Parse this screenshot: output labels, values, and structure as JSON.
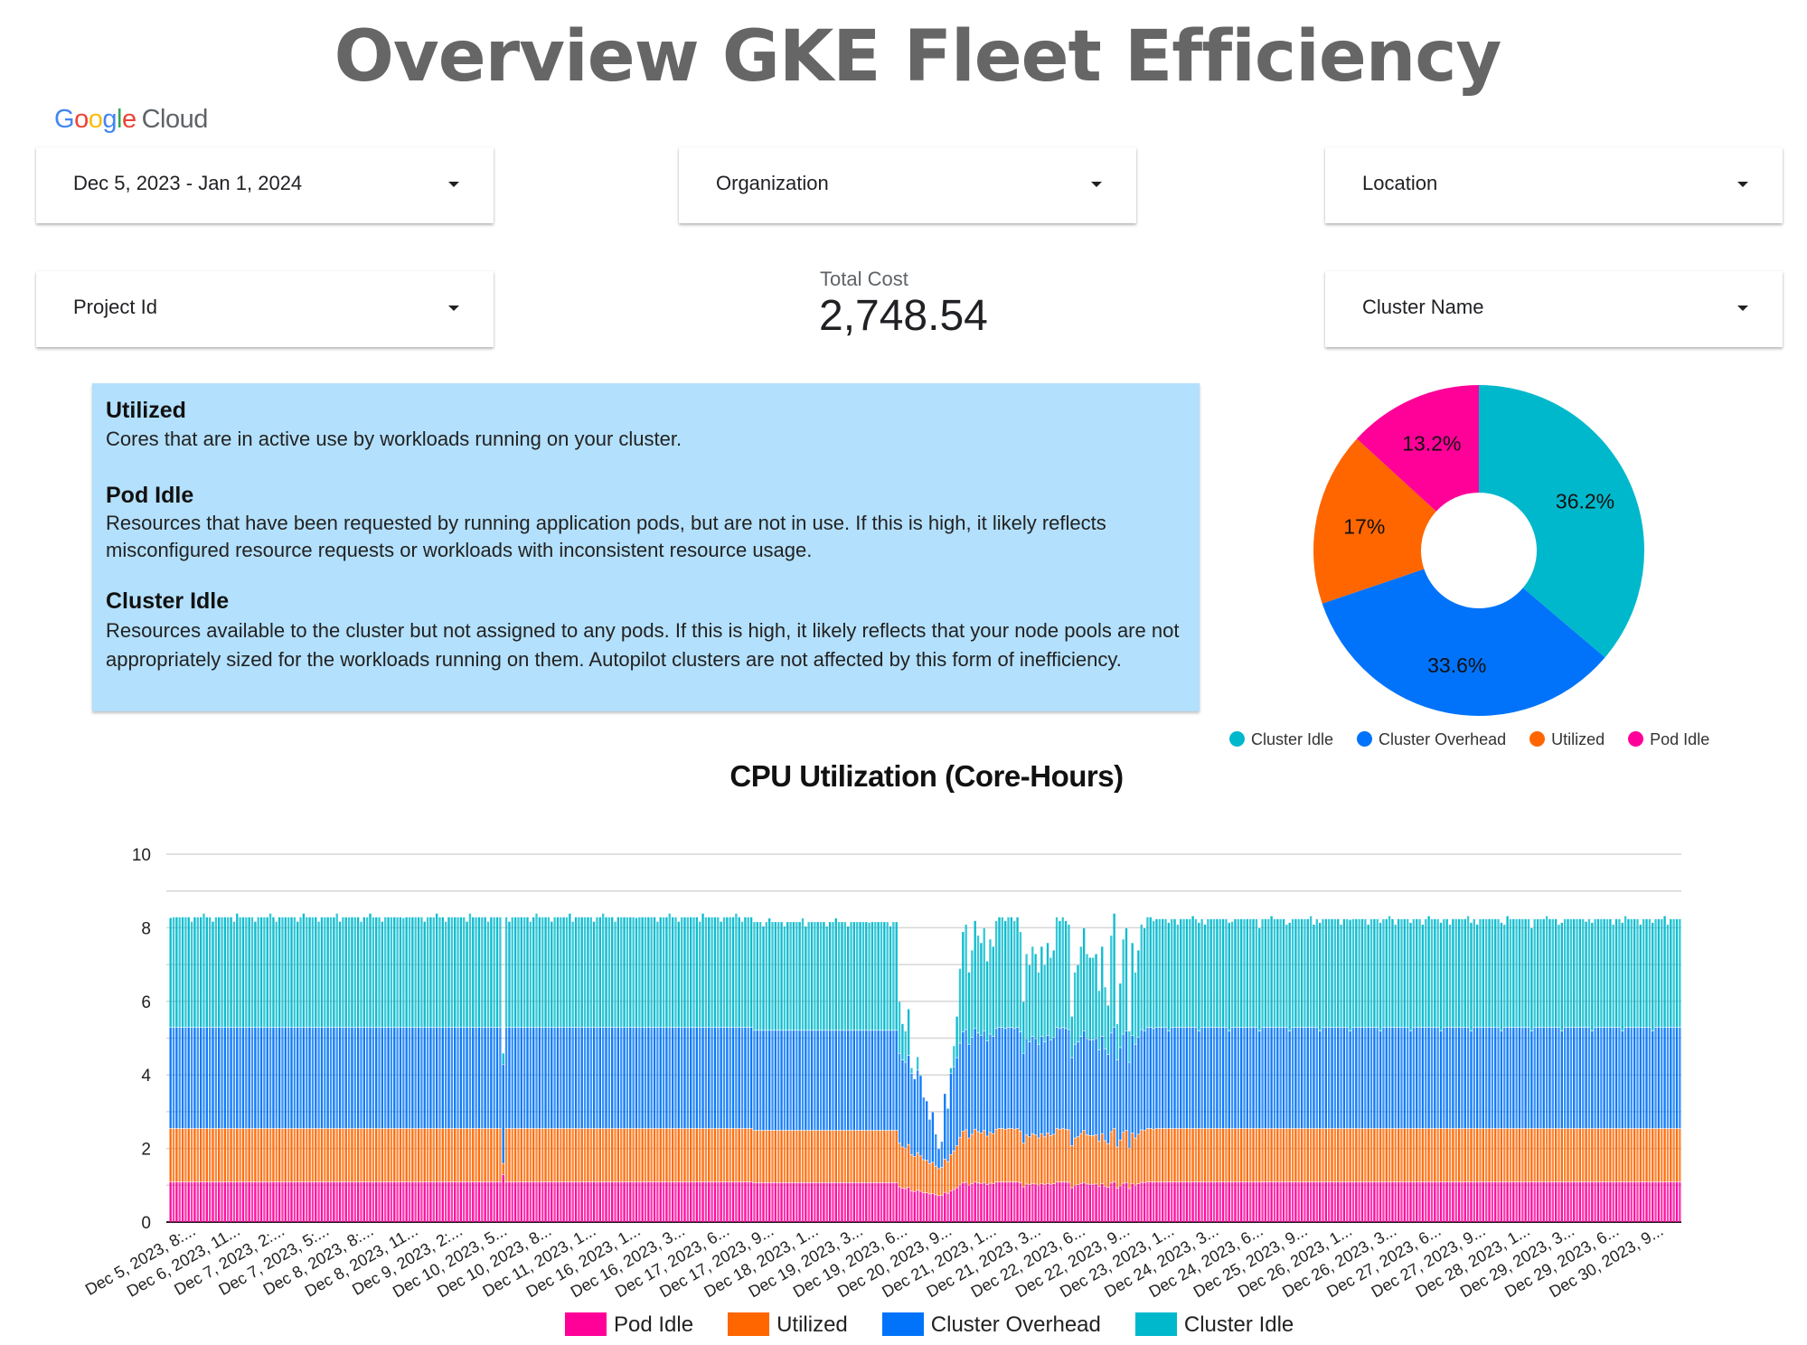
{
  "header": {
    "title": "Overview GKE Fleet Efficiency",
    "logo": {
      "google": [
        "G",
        "o",
        "o",
        "g",
        "l",
        "e"
      ],
      "cloud": "Cloud"
    }
  },
  "filters": {
    "date_range": {
      "label": "Dec 5, 2023 - Jan 1, 2024",
      "icon": "caret-down-icon"
    },
    "organization": {
      "label": "Organization",
      "icon": "caret-down-icon"
    },
    "location": {
      "label": "Location",
      "icon": "caret-down-icon"
    },
    "project_id": {
      "label": "Project Id",
      "icon": "caret-down-icon"
    },
    "cluster_name": {
      "label": "Cluster Name",
      "icon": "caret-down-icon"
    }
  },
  "scorecard": {
    "label": "Total Cost",
    "value": "2,748.54"
  },
  "info": [
    {
      "heading": "Utilized",
      "text": "Cores that are in active use by workloads running on your cluster."
    },
    {
      "heading": "Pod Idle",
      "text": "Resources that have been requested by running application pods, but are not in use. If this is high, it likely reflects misconfigured resource requests or workloads with inconsistent resource usage."
    },
    {
      "heading": "Cluster Idle",
      "text": "Resources available to the cluster but not assigned to any pods. If this is high, it likely reflects that your node pools are not appropriately sized for the workloads running on them. Autopilot clusters are not affected by this form of inefficiency."
    }
  ],
  "colors": {
    "pod_idle": "#ff0099",
    "utilized": "#ff6600",
    "cluster_overhead": "#0073fa",
    "cluster_idle": "#00b8cc",
    "info_bg": "#b3e0fc",
    "title_gray": "#666666"
  },
  "chart_data": [
    {
      "type": "pie",
      "title": "",
      "donut": true,
      "legend_position": "bottom",
      "slices": [
        {
          "name": "Cluster Idle",
          "value": 36.2,
          "label": "36.2%",
          "color": "#00b8cc"
        },
        {
          "name": "Cluster Overhead",
          "value": 33.6,
          "label": "33.6%",
          "color": "#0073fa"
        },
        {
          "name": "Utilized",
          "value": 17.0,
          "label": "17%",
          "color": "#ff6600"
        },
        {
          "name": "Pod Idle",
          "value": 13.2,
          "label": "13.2%",
          "color": "#ff0099"
        }
      ],
      "legend": [
        "Cluster Idle",
        "Cluster Overhead",
        "Utilized",
        "Pod Idle"
      ]
    },
    {
      "type": "bar",
      "stacked": true,
      "title": "CPU Utilization (Core-Hours)",
      "xlabel": "",
      "ylabel": "",
      "ylim": [
        0,
        10
      ],
      "yticks": [
        0,
        2,
        4,
        6,
        8,
        10
      ],
      "grid": true,
      "legend_position": "bottom",
      "series_order": [
        "Pod Idle",
        "Utilized",
        "Cluster Overhead",
        "Cluster Idle"
      ],
      "series_colors": [
        "#ff0099",
        "#ff6600",
        "#0073fa",
        "#00b8cc"
      ],
      "x_tick_labels": [
        "Dec 5, 2023, 8:...",
        "Dec 6, 2023, 11...",
        "Dec 7, 2023, 2:...",
        "Dec 7, 2023, 5:...",
        "Dec 8, 2023, 8:...",
        "Dec 8, 2023, 11...",
        "Dec 9, 2023, 2:...",
        "Dec 10, 2023, 5...",
        "Dec 10, 2023, 8...",
        "Dec 11, 2023, 1...",
        "Dec 16, 2023, 1...",
        "Dec 16, 2023, 3...",
        "Dec 17, 2023, 6...",
        "Dec 17, 2023, 9...",
        "Dec 18, 2023, 1...",
        "Dec 19, 2023, 3...",
        "Dec 19, 2023, 6...",
        "Dec 20, 2023, 9...",
        "Dec 21, 2023, 1...",
        "Dec 21, 2023, 3...",
        "Dec 22, 2023, 6...",
        "Dec 22, 2023, 9...",
        "Dec 23, 2023, 1...",
        "Dec 24, 2023, 3...",
        "Dec 24, 2023, 6...",
        "Dec 25, 2023, 9...",
        "Dec 26, 2023, 1...",
        "Dec 26, 2023, 3...",
        "Dec 27, 2023, 6...",
        "Dec 27, 2023, 9...",
        "Dec 28, 2023, 1...",
        "Dec 29, 2023, 3...",
        "Dec 29, 2023, 6...",
        "Dec 30, 2023, 9..."
      ],
      "typical_stack": {
        "Pod Idle": 1.1,
        "Utilized": 1.45,
        "Cluster Overhead": 2.75,
        "Cluster Idle": 3.0
      },
      "bar_count": 500,
      "segments": [
        {
          "from": 0,
          "to": 109,
          "Pod Idle": 1.1,
          "Utilized": 1.45,
          "Cluster Overhead": 2.75,
          "Cluster Idle": 3.0
        },
        {
          "from": 110,
          "to": 110,
          "Pod Idle": 1.3,
          "Utilized": 0.3,
          "Cluster Overhead": 2.7,
          "Cluster Idle": 0.2
        },
        {
          "from": 111,
          "to": 192,
          "Pod Idle": 1.1,
          "Utilized": 1.45,
          "Cluster Overhead": 2.75,
          "Cluster Idle": 3.0
        },
        {
          "from": 193,
          "to": 240,
          "Pod Idle": 1.08,
          "Utilized": 1.42,
          "Cluster Overhead": 2.72,
          "Cluster Idle": 2.95
        }
      ],
      "dip_totals": [
        6.0,
        5.4,
        5.2,
        5.8,
        4.2,
        3.9,
        4.5,
        4.0,
        3.4,
        3.3,
        2.8,
        3.0,
        2.4,
        2.0,
        2.2,
        3.5,
        3.1,
        4.2,
        4.8,
        5.6,
        6.9,
        7.9,
        8.1,
        6.8,
        7.4,
        8.2,
        7.8,
        7.6,
        8.0,
        7.1,
        7.7,
        7.5,
        8.2,
        8.3,
        8.3,
        8.2,
        8.3,
        8.3,
        8.2,
        8.3,
        7.9,
        6.0,
        7.3,
        7.0,
        7.5,
        7.3,
        6.8,
        7.5,
        7.0,
        7.6,
        7.2,
        7.4,
        8.3,
        8.2,
        8.3,
        8.2,
        8.1,
        5.6,
        6.8,
        7.0,
        7.5,
        8.0,
        7.3,
        7.2,
        7.2,
        7.3,
        6.3,
        7.5,
        6.4,
        5.9,
        7.8,
        8.4,
        5.4,
        6.5,
        7.7,
        8.0,
        5.2,
        7.6,
        6.8,
        7.4,
        8.1,
        8.0,
        8.3,
        8.3,
        8.2
      ],
      "tail_from": 326,
      "tail_stack": {
        "Pod Idle": 1.1,
        "Utilized": 1.45,
        "Cluster Overhead": 2.75,
        "Cluster Idle": 2.95
      }
    }
  ],
  "bar_legend": [
    {
      "name": "Pod Idle",
      "color": "#ff0099"
    },
    {
      "name": "Utilized",
      "color": "#ff6600"
    },
    {
      "name": "Cluster Overhead",
      "color": "#0073fa"
    },
    {
      "name": "Cluster Idle",
      "color": "#00b8cc"
    }
  ]
}
